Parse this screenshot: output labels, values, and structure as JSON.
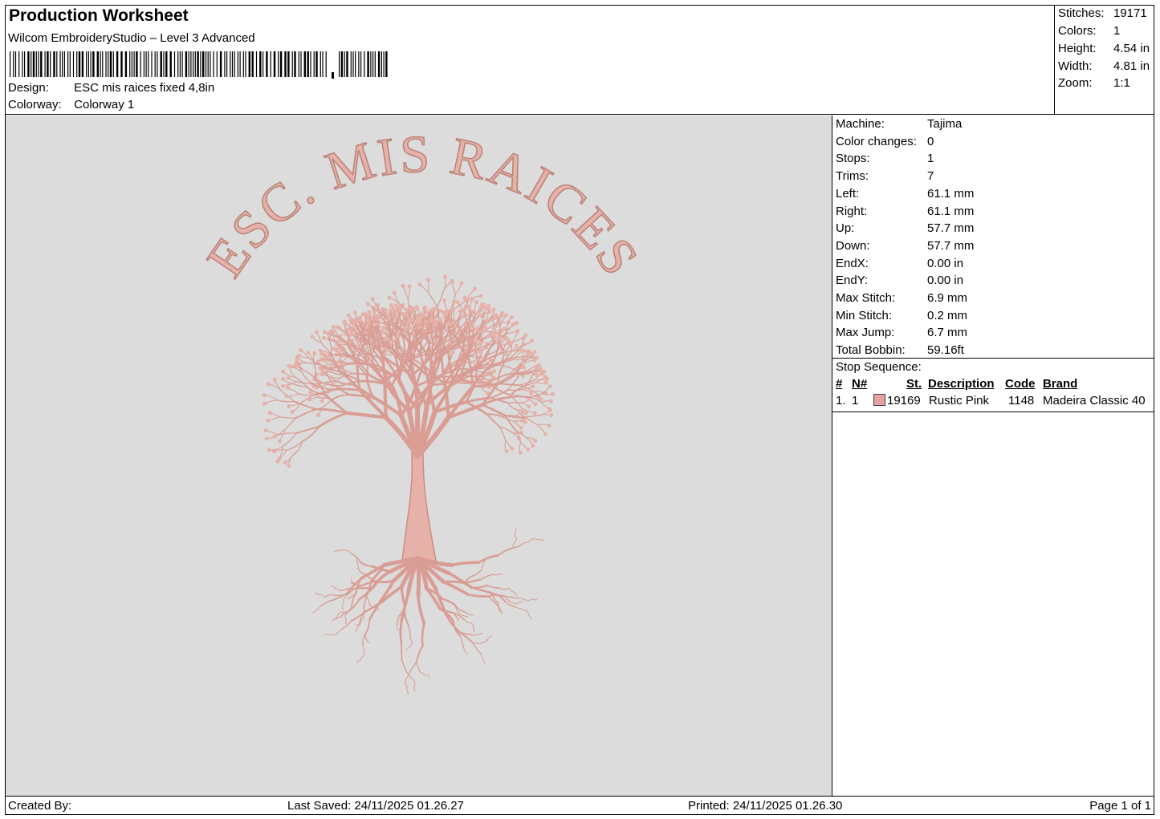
{
  "header": {
    "title": "Production Worksheet",
    "software": "Wilcom EmbroideryStudio – Level 3 Advanced",
    "design_label": "Design:",
    "design_value": "ESC mis raices fixed 4,8in",
    "colorway_label": "Colorway:",
    "colorway_value": "Colorway 1"
  },
  "stats": [
    {
      "label": "Stitches:",
      "value": "19171"
    },
    {
      "label": "Colors:",
      "value": "1"
    },
    {
      "label": "Height:",
      "value": "4.54 in"
    },
    {
      "label": "Width:",
      "value": "4.81 in"
    },
    {
      "label": "Zoom:",
      "value": "1:1"
    }
  ],
  "machine": [
    {
      "label": "Machine:",
      "value": "Tajima"
    },
    {
      "label": "Color changes:",
      "value": "0"
    },
    {
      "label": "Stops:",
      "value": "1"
    },
    {
      "label": "Trims:",
      "value": "7"
    },
    {
      "label": "Left:",
      "value": "61.1 mm"
    },
    {
      "label": "Right:",
      "value": "61.1 mm"
    },
    {
      "label": "Up:",
      "value": "57.7 mm"
    },
    {
      "label": "Down:",
      "value": "57.7 mm"
    },
    {
      "label": "EndX:",
      "value": "0.00 in"
    },
    {
      "label": "EndY:",
      "value": "0.00 in"
    },
    {
      "label": "Max Stitch:",
      "value": "6.9 mm"
    },
    {
      "label": "Min Stitch:",
      "value": "0.2 mm"
    },
    {
      "label": "Max Jump:",
      "value": "6.7 mm"
    },
    {
      "label": "Total Bobbin:",
      "value": "59.16ft"
    }
  ],
  "sequence": {
    "title": "Stop Sequence:",
    "headers": {
      "num": "#",
      "needle": "N#",
      "stitches": "St.",
      "description": "Description",
      "code": "Code",
      "brand": "Brand"
    },
    "rows": [
      {
        "num": "1.",
        "needle": "1",
        "color": "#e8a0a0",
        "stitches": "19169",
        "description": "Rustic Pink",
        "code": "1148",
        "brand": "Madeira Classic 40"
      }
    ]
  },
  "design": {
    "text": "ESC. MIS RAICES",
    "thread_color": "#e6b1a8",
    "thread_shadow": "#b98278",
    "background": "#dcdcdc"
  },
  "footer": {
    "created_by": "Created By:",
    "last_saved": "Last Saved: 24/11/2025 01.26.27",
    "printed": "Printed: 24/11/2025 01.26.30",
    "page": "Page 1 of 1"
  }
}
